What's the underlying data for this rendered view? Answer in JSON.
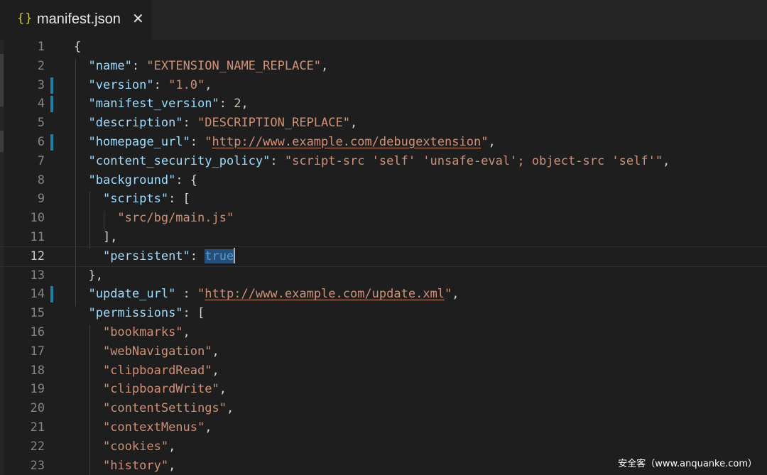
{
  "tab": {
    "icon": "{}",
    "title": "manifest.json",
    "close_glyph": "✕"
  },
  "editor": {
    "active_line": 12,
    "lines": [
      {
        "n": "1",
        "tokens": [
          {
            "t": "{",
            "c": "p"
          }
        ]
      },
      {
        "n": "2",
        "tokens": [
          {
            "t": "  ",
            "c": "p"
          },
          {
            "t": "\"name\"",
            "c": "k"
          },
          {
            "t": ": ",
            "c": "p"
          },
          {
            "t": "\"EXTENSION_NAME_REPLACE\"",
            "c": "s"
          },
          {
            "t": ",",
            "c": "p"
          }
        ]
      },
      {
        "n": "3",
        "mark": true,
        "tokens": [
          {
            "t": "  ",
            "c": "p"
          },
          {
            "t": "\"version\"",
            "c": "k"
          },
          {
            "t": ": ",
            "c": "p"
          },
          {
            "t": "\"1.0\"",
            "c": "s"
          },
          {
            "t": ",",
            "c": "p"
          }
        ]
      },
      {
        "n": "4",
        "mark": true,
        "tokens": [
          {
            "t": "  ",
            "c": "p"
          },
          {
            "t": "\"manifest_version\"",
            "c": "k"
          },
          {
            "t": ": ",
            "c": "p"
          },
          {
            "t": "2",
            "c": "n"
          },
          {
            "t": ",",
            "c": "p"
          }
        ]
      },
      {
        "n": "5",
        "tokens": [
          {
            "t": "  ",
            "c": "p"
          },
          {
            "t": "\"description\"",
            "c": "k"
          },
          {
            "t": ": ",
            "c": "p"
          },
          {
            "t": "\"DESCRIPTION_REPLACE\"",
            "c": "s"
          },
          {
            "t": ",",
            "c": "p"
          }
        ]
      },
      {
        "n": "6",
        "mark": true,
        "tokens": [
          {
            "t": "  ",
            "c": "p"
          },
          {
            "t": "\"homepage_url\"",
            "c": "k"
          },
          {
            "t": ": ",
            "c": "p"
          },
          {
            "t": "\"",
            "c": "s"
          },
          {
            "t": "http://www.example.com/debugextension",
            "c": "s u"
          },
          {
            "t": "\"",
            "c": "s"
          },
          {
            "t": ",",
            "c": "p"
          }
        ]
      },
      {
        "n": "7",
        "tokens": [
          {
            "t": "  ",
            "c": "p"
          },
          {
            "t": "\"content_security_policy\"",
            "c": "k"
          },
          {
            "t": ": ",
            "c": "p"
          },
          {
            "t": "\"script-src 'self' 'unsafe-eval'; object-src 'self'\"",
            "c": "s"
          },
          {
            "t": ",",
            "c": "p"
          }
        ]
      },
      {
        "n": "8",
        "tokens": [
          {
            "t": "  ",
            "c": "p"
          },
          {
            "t": "\"background\"",
            "c": "k"
          },
          {
            "t": ": {",
            "c": "p"
          }
        ]
      },
      {
        "n": "9",
        "tokens": [
          {
            "t": "    ",
            "c": "p"
          },
          {
            "t": "\"scripts\"",
            "c": "k"
          },
          {
            "t": ": [",
            "c": "p"
          }
        ]
      },
      {
        "n": "10",
        "tokens": [
          {
            "t": "      ",
            "c": "p"
          },
          {
            "t": "\"src/bg/main.js\"",
            "c": "s"
          }
        ]
      },
      {
        "n": "11",
        "tokens": [
          {
            "t": "    ],",
            "c": "p"
          }
        ]
      },
      {
        "n": "12",
        "tokens": [
          {
            "t": "    ",
            "c": "p"
          },
          {
            "t": "\"persistent\"",
            "c": "k"
          },
          {
            "t": ": ",
            "c": "p"
          },
          {
            "t": "true",
            "c": "b sel"
          },
          {
            "t": "",
            "c": "cursor"
          }
        ]
      },
      {
        "n": "13",
        "tokens": [
          {
            "t": "  },",
            "c": "p"
          }
        ]
      },
      {
        "n": "14",
        "mark": true,
        "tokens": [
          {
            "t": "  ",
            "c": "p"
          },
          {
            "t": "\"update_url\"",
            "c": "k"
          },
          {
            "t": " : ",
            "c": "p"
          },
          {
            "t": "\"",
            "c": "s"
          },
          {
            "t": "http://www.example.com/update.xml",
            "c": "s u"
          },
          {
            "t": "\"",
            "c": "s"
          },
          {
            "t": ",",
            "c": "p"
          }
        ]
      },
      {
        "n": "15",
        "tokens": [
          {
            "t": "  ",
            "c": "p"
          },
          {
            "t": "\"permissions\"",
            "c": "k"
          },
          {
            "t": ": [",
            "c": "p"
          }
        ]
      },
      {
        "n": "16",
        "tokens": [
          {
            "t": "    ",
            "c": "p"
          },
          {
            "t": "\"bookmarks\"",
            "c": "s"
          },
          {
            "t": ",",
            "c": "p"
          }
        ]
      },
      {
        "n": "17",
        "tokens": [
          {
            "t": "    ",
            "c": "p"
          },
          {
            "t": "\"webNavigation\"",
            "c": "s"
          },
          {
            "t": ",",
            "c": "p"
          }
        ]
      },
      {
        "n": "18",
        "tokens": [
          {
            "t": "    ",
            "c": "p"
          },
          {
            "t": "\"clipboardRead\"",
            "c": "s"
          },
          {
            "t": ",",
            "c": "p"
          }
        ]
      },
      {
        "n": "19",
        "tokens": [
          {
            "t": "    ",
            "c": "p"
          },
          {
            "t": "\"clipboardWrite\"",
            "c": "s"
          },
          {
            "t": ",",
            "c": "p"
          }
        ]
      },
      {
        "n": "20",
        "tokens": [
          {
            "t": "    ",
            "c": "p"
          },
          {
            "t": "\"contentSettings\"",
            "c": "s"
          },
          {
            "t": ",",
            "c": "p"
          }
        ]
      },
      {
        "n": "21",
        "tokens": [
          {
            "t": "    ",
            "c": "p"
          },
          {
            "t": "\"contextMenus\"",
            "c": "s"
          },
          {
            "t": ",",
            "c": "p"
          }
        ]
      },
      {
        "n": "22",
        "tokens": [
          {
            "t": "    ",
            "c": "p"
          },
          {
            "t": "\"cookies\"",
            "c": "s"
          },
          {
            "t": ",",
            "c": "p"
          }
        ]
      },
      {
        "n": "23",
        "tokens": [
          {
            "t": "    ",
            "c": "p"
          },
          {
            "t": "\"history\"",
            "c": "s"
          },
          {
            "t": ",",
            "c": "p"
          }
        ]
      }
    ]
  },
  "watermark": "安全客（www.anquanke.com）",
  "colors": {
    "key": "#9cdcfe",
    "string": "#ce9178",
    "number": "#b5cea8",
    "boolean": "#569cd6",
    "gutter_change_marker": "#1b81a8"
  }
}
